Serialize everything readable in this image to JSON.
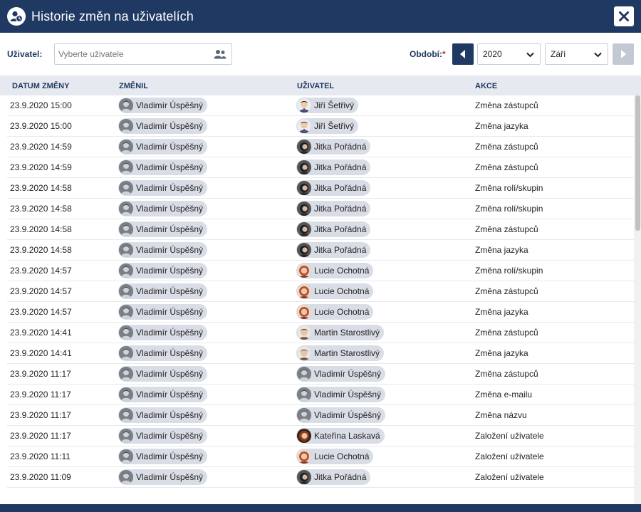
{
  "window": {
    "title": "Historie změn na uživatelích"
  },
  "filters": {
    "user_label": "Uživatel:",
    "user_placeholder": "Vyberte uživatele",
    "period_label": "Období:",
    "required_mark": "*",
    "year": "2020",
    "month": "Září"
  },
  "table": {
    "columns": [
      "DATUM ZMĚNY",
      "ZMĚNIL",
      "UŽIVATEL",
      "AKCE"
    ],
    "rows": [
      {
        "date": "23.9.2020 15:00",
        "changed_by": "Vladimír Úspěšný",
        "user": "Jiří Šetřivý",
        "user_avatar": "man-cartoon",
        "action": "Změna zástupců"
      },
      {
        "date": "23.9.2020 15:00",
        "changed_by": "Vladimír Úspěšný",
        "user": "Jiří Šetřivý",
        "user_avatar": "man-cartoon",
        "action": "Změna jazyka"
      },
      {
        "date": "23.9.2020 14:59",
        "changed_by": "Vladimír Úspěšný",
        "user": "Jitka Pořádná",
        "user_avatar": "dark-hair",
        "action": "Změna zástupců"
      },
      {
        "date": "23.9.2020 14:59",
        "changed_by": "Vladimír Úspěšný",
        "user": "Jitka Pořádná",
        "user_avatar": "dark-hair",
        "action": "Změna zástupců"
      },
      {
        "date": "23.9.2020 14:58",
        "changed_by": "Vladimír Úspěšný",
        "user": "Jitka Pořádná",
        "user_avatar": "dark-hair",
        "action": "Změna rolí/skupin"
      },
      {
        "date": "23.9.2020 14:58",
        "changed_by": "Vladimír Úspěšný",
        "user": "Jitka Pořádná",
        "user_avatar": "dark-hair",
        "action": "Změna rolí/skupin"
      },
      {
        "date": "23.9.2020 14:58",
        "changed_by": "Vladimír Úspěšný",
        "user": "Jitka Pořádná",
        "user_avatar": "dark-hair",
        "action": "Změna zástupců"
      },
      {
        "date": "23.9.2020 14:58",
        "changed_by": "Vladimír Úspěšný",
        "user": "Jitka Pořádná",
        "user_avatar": "dark-hair",
        "action": "Změna jazyka"
      },
      {
        "date": "23.9.2020 14:57",
        "changed_by": "Vladimír Úspěšný",
        "user": "Lucie Ochotná",
        "user_avatar": "red-hair",
        "action": "Změna rolí/skupin"
      },
      {
        "date": "23.9.2020 14:57",
        "changed_by": "Vladimír Úspěšný",
        "user": "Lucie Ochotná",
        "user_avatar": "red-hair",
        "action": "Změna zástupců"
      },
      {
        "date": "23.9.2020 14:57",
        "changed_by": "Vladimír Úspěšný",
        "user": "Lucie Ochotná",
        "user_avatar": "red-hair",
        "action": "Změna jazyka"
      },
      {
        "date": "23.9.2020 14:41",
        "changed_by": "Vladimír Úspěšný",
        "user": "Martin Starostlivý",
        "user_avatar": "man-brown",
        "action": "Změna zástupců"
      },
      {
        "date": "23.9.2020 14:41",
        "changed_by": "Vladimír Úspěšný",
        "user": "Martin Starostlivý",
        "user_avatar": "man-brown",
        "action": "Změna jazyka"
      },
      {
        "date": "23.9.2020 11:17",
        "changed_by": "Vladimír Úspěšný",
        "user": "Vladimír Úspěšný",
        "user_avatar": "grey",
        "action": "Změna zástupců"
      },
      {
        "date": "23.9.2020 11:17",
        "changed_by": "Vladimír Úspěšný",
        "user": "Vladimír Úspěšný",
        "user_avatar": "grey",
        "action": "Změna e-mailu"
      },
      {
        "date": "23.9.2020 11:17",
        "changed_by": "Vladimír Úspěšný",
        "user": "Vladimír Úspěšný",
        "user_avatar": "grey",
        "action": "Změna názvu"
      },
      {
        "date": "23.9.2020 11:17",
        "changed_by": "Vladimír Úspěšný",
        "user": "Kateřina Laskavá",
        "user_avatar": "auburn",
        "action": "Založení uživatele"
      },
      {
        "date": "23.9.2020 11:11",
        "changed_by": "Vladimír Úspěšný",
        "user": "Lucie Ochotná",
        "user_avatar": "red-hair",
        "action": "Založení uživatele"
      },
      {
        "date": "23.9.2020 11:09",
        "changed_by": "Vladimír Úspěšný",
        "user": "Jitka Pořádná",
        "user_avatar": "dark-hair",
        "action": "Založení uživatele"
      }
    ]
  },
  "colors": {
    "header_bg": "#1f3962",
    "table_head_bg": "#e6e9ef",
    "chip_bg": "#d9dde6"
  },
  "icons": [
    "user-history-icon",
    "close-icon",
    "users-icon",
    "chevron-left-icon",
    "chevron-right-icon",
    "chevron-down-icon",
    "avatar-icon"
  ]
}
